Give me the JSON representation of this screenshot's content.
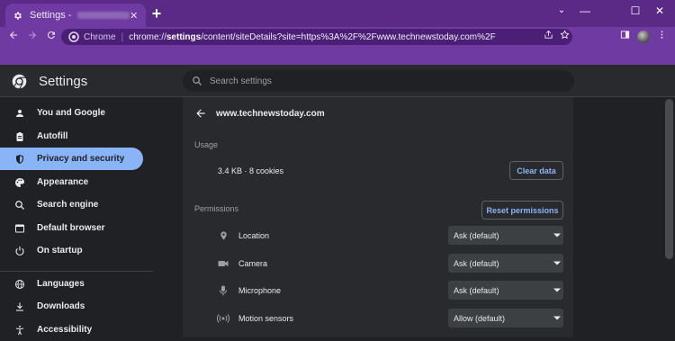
{
  "tab": {
    "title": "Settings - ",
    "close_icon": "close-icon"
  },
  "window_controls": {
    "collapse": "⌄",
    "minimize": "—",
    "maximize": "☐",
    "close": "✕"
  },
  "toolbar": {
    "scheme_label": "Chrome",
    "separator": "|",
    "url_prefix": "chrome://",
    "url_bold": "settings",
    "url_rest": "/content/siteDetails?site=https%3A%2F%2Fwww.technewstoday.com%2F"
  },
  "header": {
    "title": "Settings",
    "search_placeholder": "Search settings"
  },
  "sidebar": {
    "items": [
      {
        "label": "You and Google",
        "icon": "person-icon"
      },
      {
        "label": "Autofill",
        "icon": "clipboard-icon"
      },
      {
        "label": "Privacy and security",
        "icon": "shield-icon",
        "active": true
      },
      {
        "label": "Appearance",
        "icon": "palette-icon"
      },
      {
        "label": "Search engine",
        "icon": "search-icon"
      },
      {
        "label": "Default browser",
        "icon": "browser-icon"
      },
      {
        "label": "On startup",
        "icon": "power-icon"
      },
      {
        "label": "Languages",
        "icon": "globe-icon"
      },
      {
        "label": "Downloads",
        "icon": "download-icon"
      },
      {
        "label": "Accessibility",
        "icon": "accessibility-icon"
      }
    ]
  },
  "site_details": {
    "site": "www.technewstoday.com",
    "usage_heading": "Usage",
    "usage_text": "3.4 KB · 8 cookies",
    "clear_data_label": "Clear data",
    "permissions_heading": "Permissions",
    "reset_permissions_label": "Reset permissions",
    "permissions": [
      {
        "label": "Location",
        "value": "Ask (default)",
        "icon": "location-pin-icon"
      },
      {
        "label": "Camera",
        "value": "Ask (default)",
        "icon": "camera-icon"
      },
      {
        "label": "Microphone",
        "value": "Ask (default)",
        "icon": "microphone-icon"
      },
      {
        "label": "Motion sensors",
        "value": "Allow (default)",
        "icon": "motion-sensor-icon"
      }
    ]
  },
  "colors": {
    "frame_purple": "#6f3ba3",
    "active_blue": "#8ab4f8",
    "page_bg": "#202124",
    "card_bg": "#292a2d"
  }
}
